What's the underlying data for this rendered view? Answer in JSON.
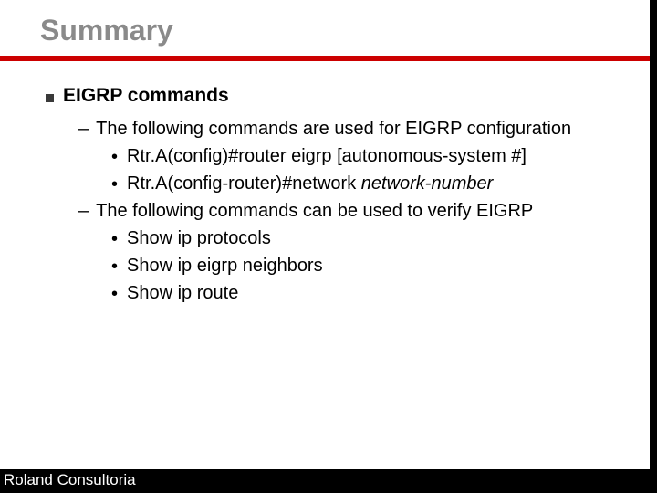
{
  "colors": {
    "accent": "#cc0000"
  },
  "title": "Summary",
  "heading1": "EIGRP commands",
  "configIntro": "The following commands are used for EIGRP configuration",
  "configCmd1": "Rtr.A(config)#router eigrp [autonomous-system #]",
  "configCmd2_prefix": "Rtr.A(config-router)#network ",
  "configCmd2_arg": "network-number",
  "verifyIntro": "The following commands can be used to verify EIGRP",
  "verifyCmd1": "Show ip protocols",
  "verifyCmd2": "Show ip eigrp neighbors",
  "verifyCmd3": "Show ip route",
  "footer": "Roland Consultoria"
}
